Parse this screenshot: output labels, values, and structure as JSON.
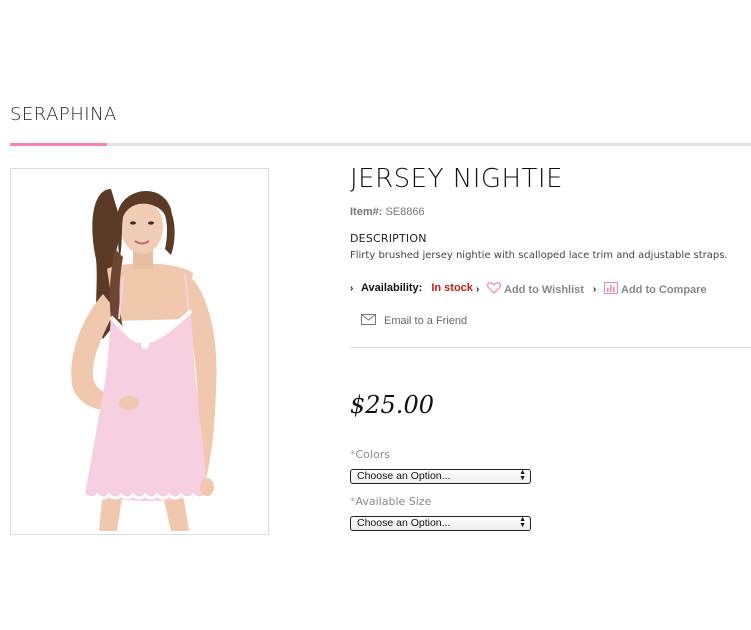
{
  "store": {
    "name": "SERAPHINA"
  },
  "product": {
    "title": "JERSEY NIGHTIE",
    "item_label": "Item#:",
    "item_number": "SE8866",
    "description_heading": "DESCRIPTION",
    "description": "Flirty brushed jersey nightie with scalloped lace trim and adjustable straps.",
    "price": "$25.00",
    "image_alt": "Model wearing pink jersey nightie"
  },
  "actions": {
    "availability_label": "Availability:",
    "availability_value": "In stock",
    "wishlist_label": "Add to Wishlist",
    "compare_label": "Add to Compare",
    "email_label": "Email to a Friend"
  },
  "options": [
    {
      "label": "Colors",
      "selected": "Choose an Option..."
    },
    {
      "label": "Available Size",
      "selected": "Choose an Option..."
    }
  ],
  "colors": {
    "accent": "#f283b6",
    "stock": "#cc1a1a",
    "garment": "#f6cfe0"
  }
}
